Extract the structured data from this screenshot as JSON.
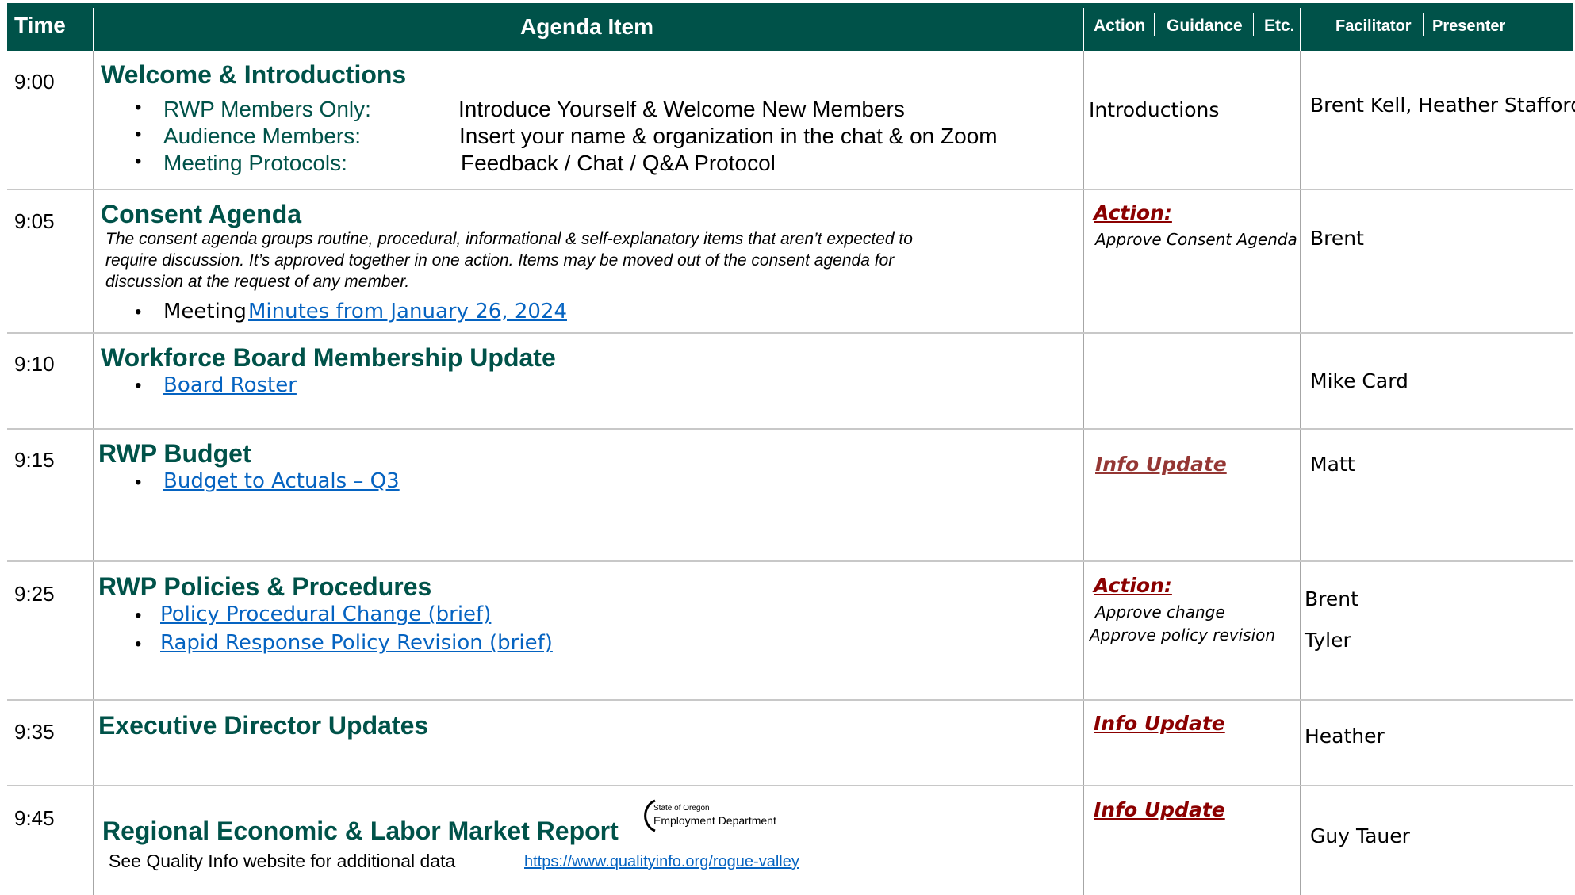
{
  "header": {
    "time": "Time",
    "agenda_item": "Agenda Item",
    "action": "Action",
    "guidance": "Guidance",
    "etc": "Etc.",
    "facilitator": "Facilitator",
    "presenter": "Presenter"
  },
  "rows": [
    {
      "time": "9:00",
      "title": "Welcome & Introductions",
      "bullets": [
        {
          "label": "RWP Members Only:",
          "text": "Introduce Yourself & Welcome New Members"
        },
        {
          "label": "Audience Members:",
          "text": "Insert your name & organization in the chat & on Zoom"
        },
        {
          "label": "Meeting Protocols:",
          "text": "Feedback / Chat / Q&A Protocol"
        }
      ],
      "action": "Introductions",
      "presenter": "Brent Kell, Heather Stafford"
    },
    {
      "time": "9:05",
      "title": "Consent Agenda",
      "description_lines": [
        "The consent agenda groups routine, procedural, informational & self-explanatory items that aren’t expected to",
        "require discussion. It’s approved together in one action. Items may be moved out of the consent agenda for",
        "discussion at the request of any member."
      ],
      "bullet_prefix": "Meeting",
      "bullet_link": "Minutes from January 26, 2024",
      "action": "Action:",
      "action_sub": "Approve Consent Agenda",
      "presenter": "Brent"
    },
    {
      "time": "9:10",
      "title": "Workforce Board Membership Update",
      "bullet_link": "Board Roster",
      "presenter": "Mike Card"
    },
    {
      "time": "9:15",
      "title": "RWP Budget",
      "bullet_link": "Budget to Actuals – Q3",
      "action": "Info Update",
      "presenter": "Matt"
    },
    {
      "time": "9:25",
      "title": "RWP Policies & Procedures",
      "bullet_links": [
        "Policy Procedural Change  (brief)",
        "Rapid Response Policy Revision (brief)"
      ],
      "action": "Action:",
      "action_subs": [
        "Approve change",
        "Approve policy revision"
      ],
      "presenters": [
        "Brent",
        "Tyler"
      ]
    },
    {
      "time": "9:35",
      "title": "Executive Director Updates",
      "action": "Info Update",
      "presenter": "Heather"
    },
    {
      "time": "9:45",
      "title": "Regional Economic & Labor Market Report",
      "logo_line1": "State of Oregon",
      "logo_line2": "Employment Department",
      "note": "See Quality Info website for additional data",
      "note_link": "https://www.qualityinfo.org/rogue-valley",
      "action": "Info Update",
      "presenter": "Guy Tauer"
    }
  ],
  "colors": {
    "header_bg": "#005249",
    "title_green": "#005249",
    "link_blue": "#0563c1",
    "action_red": "#8b0000"
  }
}
